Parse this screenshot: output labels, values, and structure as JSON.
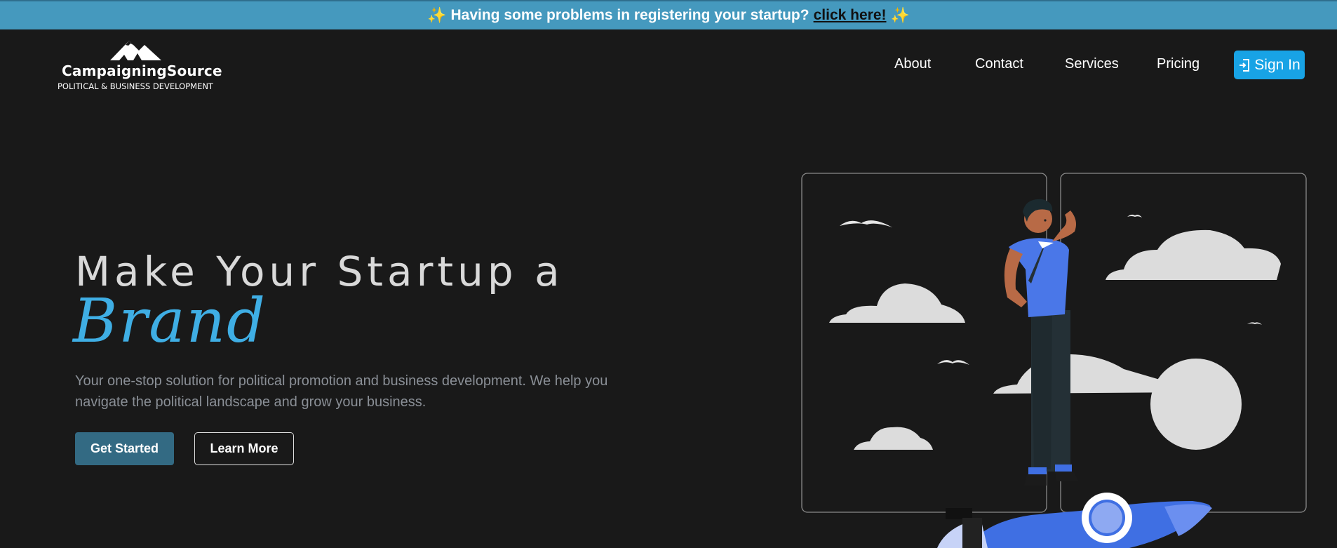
{
  "banner": {
    "text": "Having some problems in registering your startup?",
    "link": "click here!",
    "spark": "✨"
  },
  "logo": {
    "brand": "CampaigningSource",
    "tagline": "POLITICAL & BUSINESS DEVELOPMENT"
  },
  "nav": {
    "items": [
      "About",
      "Contact",
      "Services",
      "Pricing"
    ],
    "signin": "Sign In"
  },
  "hero": {
    "title": "Make Your Startup a",
    "script": "Brand",
    "description": "Your one-stop solution for political promotion and business development. We help you navigate the political landscape and grow your business.",
    "primary_button": "Get Started",
    "secondary_button": "Learn More"
  },
  "colors": {
    "background": "#191919",
    "banner": "#4599be",
    "accent": "#18a3e5",
    "script": "#3faee4",
    "primary_button": "#336a83"
  }
}
